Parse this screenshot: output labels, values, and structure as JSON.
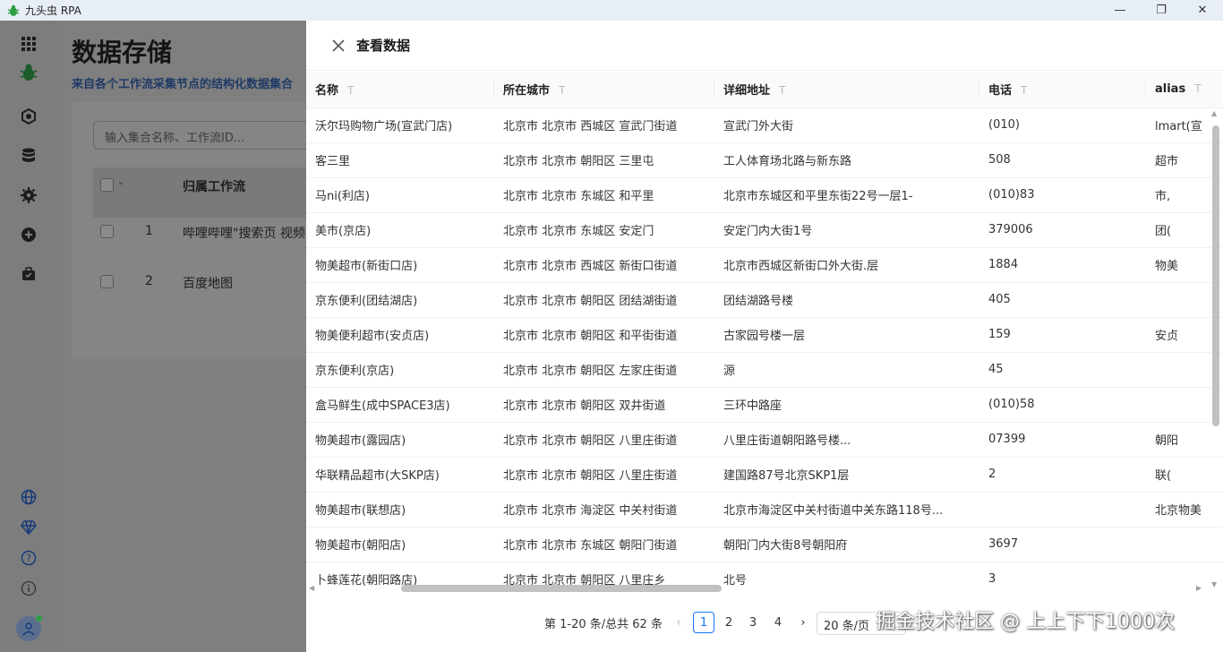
{
  "app": {
    "title": "九头虫 RPA",
    "win_min": "—",
    "win_max": "❐",
    "win_close": "✕"
  },
  "sidebar": {
    "icons": [
      "apps-grid-icon",
      "bug-logo-icon",
      "workflow-icon",
      "database-icon",
      "settings-icon",
      "add-circle-icon",
      "briefcase-icon",
      "globe-icon",
      "diamond-icon",
      "help-icon",
      "info-icon",
      "user-avatar-icon"
    ]
  },
  "main": {
    "title": "数据存储",
    "subtitle": "来自各个工作流采集节点的结构化数据集合",
    "search_placeholder": "输入集合名称、工作流ID...",
    "col_workflow": "归属工作流",
    "rows": [
      {
        "index": "1",
        "workflow": "哔哩哔哩\"搜索页 视频"
      },
      {
        "index": "2",
        "workflow": "百度地图"
      }
    ]
  },
  "drawer": {
    "title": "查看数据",
    "columns": [
      "名称",
      "所在城市",
      "详细地址",
      "电话",
      "alias"
    ],
    "filter_glyph": "T",
    "rows": [
      [
        "沃尔玛购物广场(宣武门店)",
        "北京市 北京市 西城区 宣武门街道",
        "宣武门外大街",
        "(010)",
        "lmart(宣"
      ],
      [
        "客三里",
        "北京市 北京市 朝阳区 三里屯",
        "工人体育场北路与新东路",
        "508",
        "超市"
      ],
      [
        "马ni(利店)",
        "北京市 北京市 东城区 和平里",
        "北京市东城区和平里东街22号一层1-",
        "(010)83",
        "市,"
      ],
      [
        "美市(京店)",
        "北京市 北京市 东城区 安定门",
        "安定门内大街1号",
        "379006",
        "团("
      ],
      [
        "物美超市(新街口店)",
        "北京市 北京市 西城区 新街口街道",
        "北京市西城区新街口外大街.层",
        "1884",
        "物美"
      ],
      [
        "京东便利(团结湖店)",
        "北京市 北京市 朝阳区 团结湖街道",
        "团结湖路号楼",
        "405",
        ""
      ],
      [
        "物美便利超市(安贞店)",
        "北京市 北京市 朝阳区 和平街街道",
        "古家园号楼一层",
        "159",
        "安贞"
      ],
      [
        "京东便利(京店)",
        "北京市 北京市 朝阳区 左家庄街道",
        "源",
        "45",
        ""
      ],
      [
        "盒马鲜生(成中SPACE3店)",
        "北京市 北京市 朝阳区 双井街道",
        "三环中路座",
        "(010)58",
        ""
      ],
      [
        "物美超市(露园店)",
        "北京市 北京市 朝阳区 八里庄街道",
        "八里庄街道朝阳路号楼...",
        "07399",
        "朝阳"
      ],
      [
        "华联精品超市(大SKP店)",
        "北京市 北京市 朝阳区 八里庄街道",
        "建国路87号北京SKP1层",
        "2",
        "联("
      ],
      [
        "物美超市(联想店)",
        "北京市 北京市 海淀区 中关村街道",
        "北京市海淀区中关村街道中关东路118号...",
        "",
        "北京物美"
      ],
      [
        "物美超市(朝阳店)",
        "北京市 北京市 东城区 朝阳门街道",
        "朝阳门内大街8号朝阳府",
        "3697",
        ""
      ],
      [
        "卜蜂莲花(朝阳路店)",
        "北京市 北京市 朝阳区 八里庄乡",
        "北号",
        "3",
        ""
      ]
    ]
  },
  "pagination": {
    "summary": "第 1-20 条/总共 62 条",
    "prev": "‹",
    "pages": [
      "1",
      "2",
      "3",
      "4"
    ],
    "next": "›",
    "page_size": "20 条/页"
  },
  "watermark": "掘金技术社区 @ 上上下下1000次"
}
